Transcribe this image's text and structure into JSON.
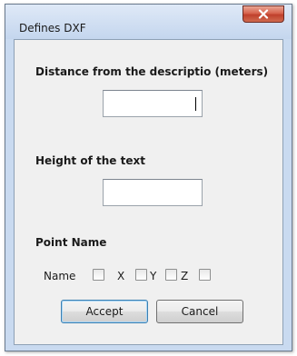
{
  "window": {
    "title": "Defines DXF",
    "close_icon": "close-x-icon"
  },
  "form": {
    "distance_label": "Distance from the descriptio (meters)",
    "distance_value": "",
    "height_label": "Height of the text",
    "height_value": "",
    "point_name_label": "Point Name",
    "checkboxes": [
      {
        "label": "Name",
        "checked": false
      },
      {
        "label": "X",
        "checked": false
      },
      {
        "label": "Y",
        "checked": false
      },
      {
        "label": "Z",
        "checked": false
      }
    ]
  },
  "buttons": {
    "accept_label": "Accept",
    "cancel_label": "Cancel"
  },
  "colors": {
    "titlebar": "#c9daf0",
    "close_button": "#c7452f",
    "client_background": "#f0f0f0"
  }
}
